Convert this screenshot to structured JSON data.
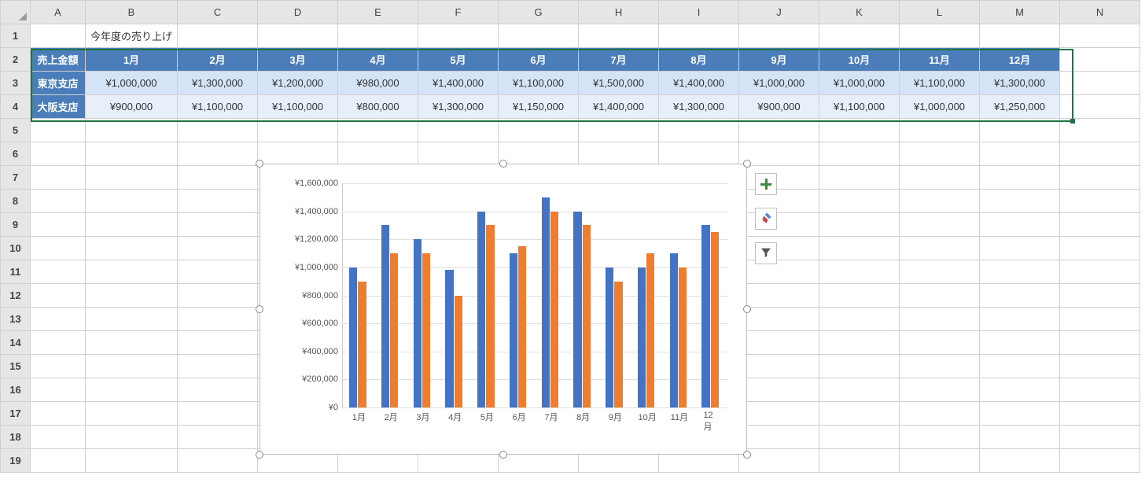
{
  "columns": [
    "A",
    "B",
    "C",
    "D",
    "E",
    "F",
    "G",
    "H",
    "I",
    "J",
    "K",
    "L",
    "M",
    "N"
  ],
  "rows": [
    "1",
    "2",
    "3",
    "4",
    "5",
    "6",
    "7",
    "8",
    "9",
    "10",
    "11",
    "12",
    "13",
    "14",
    "15",
    "16",
    "17",
    "18",
    "19"
  ],
  "cells": {
    "B1": "今年度の売り上げ",
    "A2": "売上金額",
    "B2": "1月",
    "C2": "2月",
    "D2": "3月",
    "E2": "4月",
    "F2": "5月",
    "G2": "6月",
    "H2": "7月",
    "I2": "8月",
    "J2": "9月",
    "K2": "10月",
    "L2": "11月",
    "M2": "12月",
    "A3": "東京支店",
    "B3": "¥1,000,000",
    "C3": "¥1,300,000",
    "D3": "¥1,200,000",
    "E3": "¥980,000",
    "F3": "¥1,400,000",
    "G3": "¥1,100,000",
    "H3": "¥1,500,000",
    "I3": "¥1,400,000",
    "J3": "¥1,000,000",
    "K3": "¥1,000,000",
    "L3": "¥1,100,000",
    "M3": "¥1,300,000",
    "A4": "大阪支店",
    "B4": "¥900,000",
    "C4": "¥1,100,000",
    "D4": "¥1,100,000",
    "E4": "¥800,000",
    "F4": "¥1,300,000",
    "G4": "¥1,150,000",
    "H4": "¥1,400,000",
    "I4": "¥1,300,000",
    "J4": "¥900,000",
    "K4": "¥1,100,000",
    "L4": "¥1,000,000",
    "M4": "¥1,250,000"
  },
  "chart_data": {
    "type": "bar",
    "categories": [
      "1月",
      "2月",
      "3月",
      "4月",
      "5月",
      "6月",
      "7月",
      "8月",
      "9月",
      "10月",
      "11月",
      "12月"
    ],
    "series": [
      {
        "name": "東京支店",
        "values": [
          1000000,
          1300000,
          1200000,
          980000,
          1400000,
          1100000,
          1500000,
          1400000,
          1000000,
          1000000,
          1100000,
          1300000
        ]
      },
      {
        "name": "大阪支店",
        "values": [
          900000,
          1100000,
          1100000,
          800000,
          1300000,
          1150000,
          1400000,
          1300000,
          900000,
          1100000,
          1000000,
          1250000
        ]
      }
    ],
    "ylim": [
      0,
      1600000
    ],
    "ytick_step": 200000,
    "ytick_prefix": "¥",
    "ytick_labels": [
      "¥0",
      "¥200,000",
      "¥400,000",
      "¥600,000",
      "¥800,000",
      "¥1,000,000",
      "¥1,200,000",
      "¥1,400,000",
      "¥1,600,000"
    ],
    "colors": [
      "#4472c4",
      "#ed7d31"
    ]
  },
  "side_buttons": {
    "plus": "chart-elements",
    "brush": "chart-styles",
    "filter": "chart-filters"
  }
}
